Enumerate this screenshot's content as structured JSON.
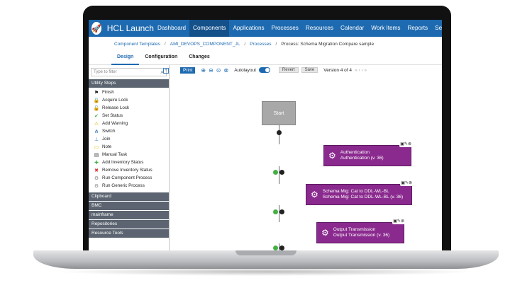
{
  "app": {
    "title": "HCL Launch"
  },
  "nav": [
    "Dashboard",
    "Components",
    "Applications",
    "Processes",
    "Resources",
    "Calendar",
    "Work Items",
    "Reports",
    "Settings"
  ],
  "breadcrumb": {
    "items": [
      "Component Templates",
      "AMI_DEVOPS_COMPONENT_JL",
      "Processes"
    ],
    "current": "Process: Schema Migration Compare sample"
  },
  "tabs": [
    "Design",
    "Configuration",
    "Changes"
  ],
  "sidebar": {
    "filter_placeholder": "Type to filter",
    "utility_header": "Utility Steps",
    "steps": [
      {
        "label": "Finish",
        "icon": "flag-icon"
      },
      {
        "label": "Acquire Lock",
        "icon": "lock-icon"
      },
      {
        "label": "Release Lock",
        "icon": "unlock-icon"
      },
      {
        "label": "Set Status",
        "icon": "check-circle-icon"
      },
      {
        "label": "Add Warning",
        "icon": "warning-icon"
      },
      {
        "label": "Switch",
        "icon": "switch-icon"
      },
      {
        "label": "Join",
        "icon": "join-icon"
      },
      {
        "label": "Note",
        "icon": "note-icon"
      },
      {
        "label": "Manual Task",
        "icon": "task-icon"
      },
      {
        "label": "Add Inventory Status",
        "icon": "add-inventory-icon"
      },
      {
        "label": "Remove Inventory Status",
        "icon": "remove-inventory-icon"
      },
      {
        "label": "Run Component Process",
        "icon": "run-icon"
      },
      {
        "label": "Run Generic Process",
        "icon": "run-icon"
      }
    ],
    "sections": [
      "Clipboard",
      "BMC",
      "mainframe",
      "Repositories",
      "Resource Tools"
    ]
  },
  "toolbar": {
    "print": "Print",
    "autolayout": "Autolayout",
    "revert": "Revert",
    "save": "Save",
    "version": "Version 4 of 4"
  },
  "flow": {
    "start": "Start",
    "nodes": [
      {
        "line1": "Authentication",
        "line2": "Authentication (v. 36)"
      },
      {
        "line1": "Schema Mig: Cat to DDL-WL-BL",
        "line2": "Schema Mig: Cat to DDL-WL-BL (v. 36)"
      },
      {
        "line1": "Output Transmission",
        "line2": "Output Transmission (v. 36)"
      }
    ]
  },
  "colors": {
    "brand": "#1e6ab0",
    "node": "#8a2a8e",
    "sidebar_header": "#5b6470"
  }
}
